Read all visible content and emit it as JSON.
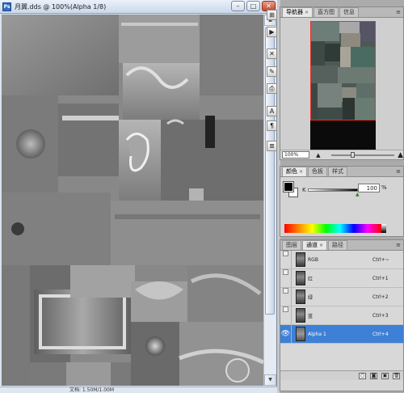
{
  "document": {
    "title": "月翼.dds @ 100%(Alpha 1/8)",
    "status_text": "文档: 1.50M/1.00M",
    "controls": {
      "minimize": "–",
      "maximize": "□",
      "close": "✕"
    },
    "canvas_color": "#8b8b8b"
  },
  "side_icons": [
    "arrange-icon",
    "play-icon",
    "tools-icon",
    "brush-icon",
    "stamp-icon",
    "text-icon",
    "paragraph-icon",
    "notes-icon"
  ],
  "navigator": {
    "tabs": [
      {
        "label": "导航器",
        "active": true
      },
      {
        "label": "直方图",
        "active": false
      },
      {
        "label": "信息",
        "active": false
      }
    ],
    "zoom": "100%",
    "view_rect_color": "#e8302a"
  },
  "color": {
    "tabs": [
      {
        "label": "颜色",
        "active": true
      },
      {
        "label": "色板",
        "active": false
      },
      {
        "label": "样式",
        "active": false
      }
    ],
    "channel_label": "K",
    "value": "100",
    "unit": "%",
    "foreground": "#000000",
    "background": "#ffffff"
  },
  "channels": {
    "tabs": [
      {
        "label": "图层",
        "active": false
      },
      {
        "label": "通道",
        "active": true
      },
      {
        "label": "路径",
        "active": false
      }
    ],
    "rows": [
      {
        "name": "RGB",
        "shortcut": "Ctrl+~",
        "visible": false,
        "selected": false
      },
      {
        "name": "红",
        "shortcut": "Ctrl+1",
        "visible": false,
        "selected": false
      },
      {
        "name": "绿",
        "shortcut": "Ctrl+2",
        "visible": false,
        "selected": false
      },
      {
        "name": "蓝",
        "shortcut": "Ctrl+3",
        "visible": false,
        "selected": false
      },
      {
        "name": "Alpha 1",
        "shortcut": "Ctrl+4",
        "visible": true,
        "selected": true
      }
    ],
    "selected_color": "#3d80d6"
  }
}
